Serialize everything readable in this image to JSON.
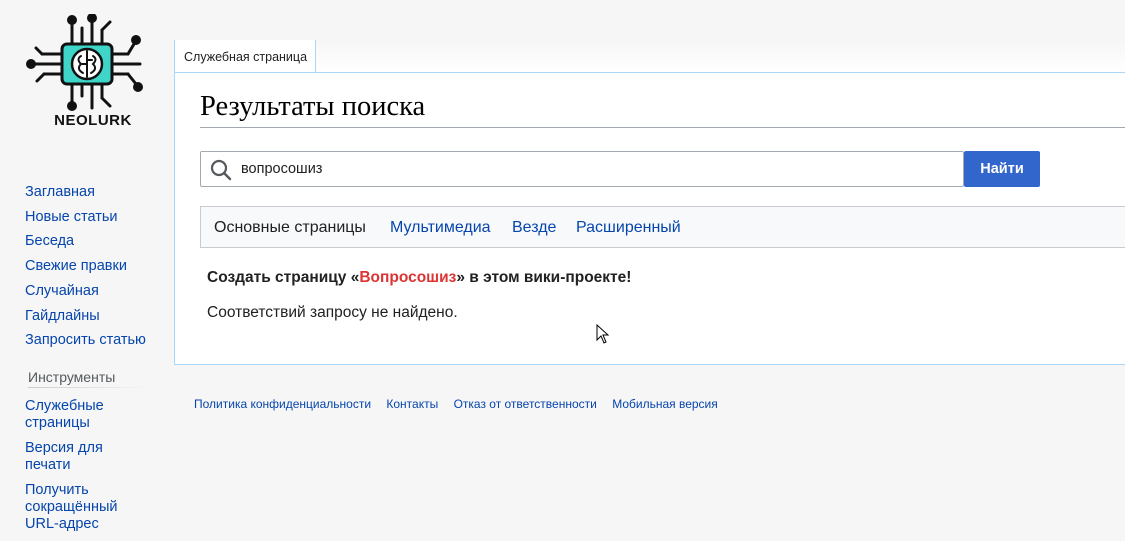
{
  "logo": {
    "text": "NEOLURK"
  },
  "sidebar": {
    "nav": [
      {
        "label": "Заглавная"
      },
      {
        "label": "Новые статьи"
      },
      {
        "label": "Беседа"
      },
      {
        "label": "Свежие правки"
      },
      {
        "label": "Случайная"
      },
      {
        "label": "Гайдлайны"
      },
      {
        "label": "Запросить статью"
      }
    ],
    "tools_heading": "Инструменты",
    "tools": [
      {
        "label": "Служебные страницы"
      },
      {
        "label": "Версия для печати"
      },
      {
        "label": "Получить сокращённый URL-адрес"
      }
    ]
  },
  "tabs": {
    "special": "Служебная страница"
  },
  "page": {
    "title": "Результаты поиска"
  },
  "search": {
    "value": "вопросошиз",
    "button": "Найти"
  },
  "profiles": {
    "items": [
      {
        "label": "Основные страницы",
        "active": true
      },
      {
        "label": "Мультимедиа",
        "active": false
      },
      {
        "label": "Везде",
        "active": false
      },
      {
        "label": "Расширенный",
        "active": false
      }
    ]
  },
  "results": {
    "create_prefix": "Создать страницу «",
    "create_link": "Вопросошиз",
    "create_suffix": "» в этом вики-проекте!",
    "no_results": "Соответствий запросу не найдено."
  },
  "footer": {
    "links": [
      {
        "label": "Политика конфиденциальности"
      },
      {
        "label": "Контакты"
      },
      {
        "label": "Отказ от ответственности"
      },
      {
        "label": "Мобильная версия"
      }
    ]
  },
  "colors": {
    "link": "#0645ad",
    "button": "#3366cc",
    "red_link": "#dd3333",
    "logo_accent": "#3dd6c8"
  }
}
